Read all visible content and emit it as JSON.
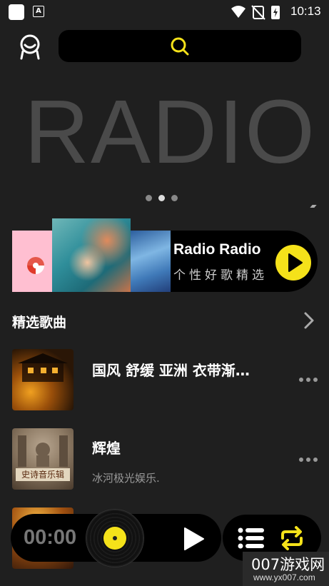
{
  "status_bar": {
    "time": "10:13",
    "app_badge": "A",
    "icons": [
      "wifi-icon",
      "no-sim-icon",
      "battery-charging-icon"
    ]
  },
  "header": {
    "avatar_icon": "user-face-icon",
    "search_icon": "search-icon"
  },
  "banner": {
    "text": "RADIO",
    "dots": 3,
    "active_dot": 1
  },
  "radio_card": {
    "title": "Radio Radio",
    "subtitle": "个性好歌精选",
    "play_icon": "play-icon",
    "accent": "#f5e21a"
  },
  "section": {
    "title": "精选歌曲",
    "more_icon": "chevron-right-icon"
  },
  "songs": [
    {
      "title": "国风 舒缓 亚洲 衣带渐…",
      "subtitle": "",
      "cover_text": ""
    },
    {
      "title": "辉煌",
      "subtitle": "冰河极光娱乐.",
      "cover_text": "史诗音乐辑"
    },
    {
      "title": "",
      "subtitle": "",
      "cover_text": ""
    }
  ],
  "player": {
    "time": "00:00",
    "play_icon": "play-icon",
    "playlist_icon": "playlist-icon",
    "repeat_icon": "repeat-icon"
  },
  "watermark": {
    "title": "007游戏网",
    "url": "www.yx007.com"
  }
}
